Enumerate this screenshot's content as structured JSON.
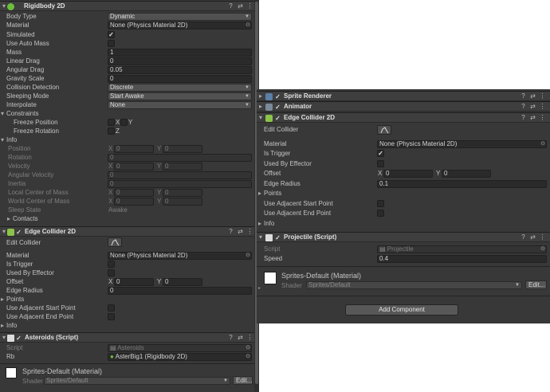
{
  "left": {
    "rigidbody": {
      "title": "Rigidbody 2D",
      "body_type_label": "Body Type",
      "body_type": "Dynamic",
      "material_label": "Material",
      "material": "None (Physics Material 2D)",
      "simulated_label": "Simulated",
      "auto_mass_label": "Use Auto Mass",
      "mass_label": "Mass",
      "mass": "1",
      "linear_drag_label": "Linear Drag",
      "linear_drag": "0",
      "angular_drag_label": "Angular Drag",
      "angular_drag": "0.05",
      "gravity_label": "Gravity Scale",
      "gravity": "0",
      "collision_label": "Collision Detection",
      "collision": "Discrete",
      "sleeping_label": "Sleeping Mode",
      "sleeping": "Start Awake",
      "interpolate_label": "Interpolate",
      "interpolate": "None",
      "constraints_label": "Constraints",
      "freeze_pos_label": "Freeze Position",
      "x": "X",
      "y": "Y",
      "freeze_rot_label": "Freeze Rotation",
      "z": "Z",
      "info_label": "Info",
      "position_label": "Position",
      "rotation_label": "Rotation",
      "velocity_label": "Velocity",
      "angular_velocity_label": "Angular Velocity",
      "inertia_label": "Inertia",
      "local_com_label": "Local Center of Mass",
      "world_com_label": "World Center of Mass",
      "sleep_state_label": "Sleep State",
      "sleep_state": "Awake",
      "contacts_label": "Contacts",
      "zero": "0"
    },
    "edge": {
      "title": "Edge Collider 2D",
      "edit_label": "Edit Collider",
      "material_label": "Material",
      "material": "None (Physics Material 2D)",
      "trigger_label": "Is Trigger",
      "effector_label": "Used By Effector",
      "offset_label": "Offset",
      "offset_x": "0",
      "offset_y": "0",
      "radius_label": "Edge Radius",
      "radius": "0",
      "points_label": "Points",
      "adj_start_label": "Use Adjacent Start Point",
      "adj_end_label": "Use Adjacent End Point",
      "info_label": "Info"
    },
    "script": {
      "title": "Asteroids (Script)",
      "script_label": "Script",
      "script": "Asteroids",
      "rb_label": "Rb",
      "rb": "AsterBig1 (Rigidbody 2D)"
    },
    "material": {
      "name": "Sprites-Default (Material)",
      "shader_label": "Shader",
      "shader": "Sprites/Default",
      "edit": "Edit..."
    }
  },
  "right": {
    "sprite_renderer": "Sprite Renderer",
    "animator": "Animator",
    "edge": {
      "title": "Edge Collider 2D",
      "edit_label": "Edit Collider",
      "material_label": "Material",
      "material": "None (Physics Material 2D)",
      "trigger_label": "Is Trigger",
      "effector_label": "Used By Effector",
      "offset_label": "Offset",
      "offset_x": "0",
      "offset_y": "0",
      "radius_label": "Edge Radius",
      "radius": "0.1",
      "points_label": "Points",
      "adj_start_label": "Use Adjacent Start Point",
      "adj_end_label": "Use Adjacent End Point",
      "info_label": "Info"
    },
    "projectile": {
      "title": "Projectile (Script)",
      "script_label": "Script",
      "script": "Projectile",
      "speed_label": "Speed",
      "speed": "0.4"
    },
    "material": {
      "name": "Sprites-Default (Material)",
      "shader_label": "Shader",
      "shader": "Sprites/Default",
      "edit": "Edit..."
    },
    "add_component": "Add Component"
  },
  "icons": {
    "help": "help-icon",
    "presets": "presets-icon",
    "menu": "kebab-menu-icon",
    "fold": "foldout-arrow-icon",
    "object_picker": "object-picker-icon",
    "edit_collider": "edit-collider-icon"
  },
  "colors": {
    "panel": "#383838",
    "header": "#3e3e3e",
    "field": "#2a2a2a",
    "rigidbody_icon": "#6bbf3a",
    "collider_icon": "#8bc34a",
    "script_icon": "#dddddd"
  }
}
